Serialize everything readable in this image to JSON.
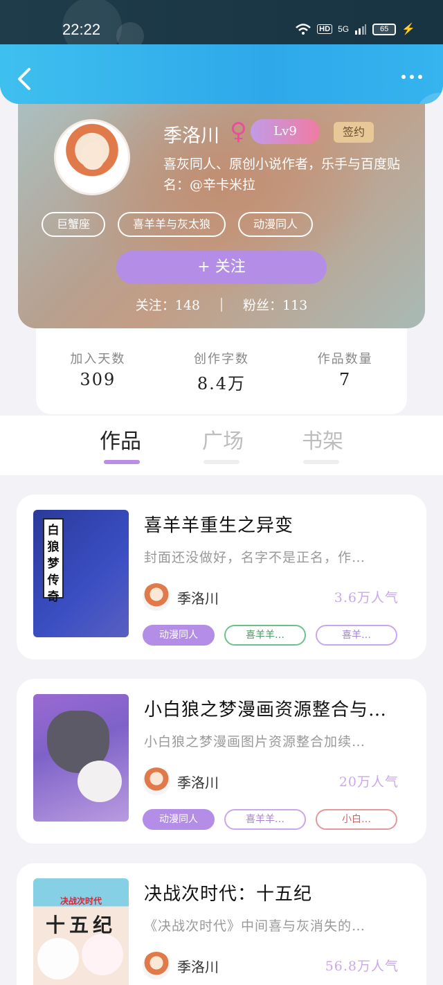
{
  "status_bar": {
    "time": "22:22",
    "hd": "HD",
    "network": "5G",
    "battery": "65"
  },
  "profile": {
    "username": "季洛川",
    "gender_symbol": "♀",
    "level": "Lv9",
    "signed_badge": "签约",
    "bio_line1": "喜灰同人、原创小说作者，乐手与百度贴",
    "bio_line2": "名：@辛卡米拉",
    "tags": [
      "巨蟹座",
      "喜羊羊与灰太狼",
      "动漫同人"
    ],
    "follow_button": "+  关注",
    "following_label": "关注：148",
    "fans_label": "粉丝：113"
  },
  "stats": [
    {
      "label": "加入天数",
      "value": "309"
    },
    {
      "label": "创作字数",
      "value": "8.4万"
    },
    {
      "label": "作品数量",
      "value": "7"
    }
  ],
  "tabs": [
    {
      "label": "作品",
      "active": true
    },
    {
      "label": "广场",
      "active": false
    },
    {
      "label": "书架",
      "active": false
    }
  ],
  "books": [
    {
      "title": "喜羊羊重生之异变",
      "description": "封面还没做好，名字不是正名，作…",
      "author": "季洛川",
      "popularity": "3.6万人气",
      "cover_text": "白狼梦传奇",
      "tags": [
        "动漫同人",
        "喜羊羊…",
        "喜羊…"
      ]
    },
    {
      "title": "小白狼之梦漫画资源整合与…",
      "description": "小白狼之梦漫画图片资源整合加续…",
      "author": "季洛川",
      "popularity": "20万人气",
      "tags": [
        "动漫同人",
        "喜羊羊…",
        "小白…"
      ]
    },
    {
      "title": "决战次时代：十五纪",
      "description": "《决战次时代》中间喜与灰消失的…",
      "author": "季洛川",
      "popularity": "56.8万人气",
      "cover_title": "决战次时代",
      "cover_big": "十五纪"
    }
  ],
  "colors": {
    "accent": "#b48de6",
    "header": "#2fb3ea",
    "popularity": "#c9a9ea"
  },
  "icons": [
    "back-icon",
    "more-icon",
    "wifi-icon",
    "female-icon"
  ]
}
